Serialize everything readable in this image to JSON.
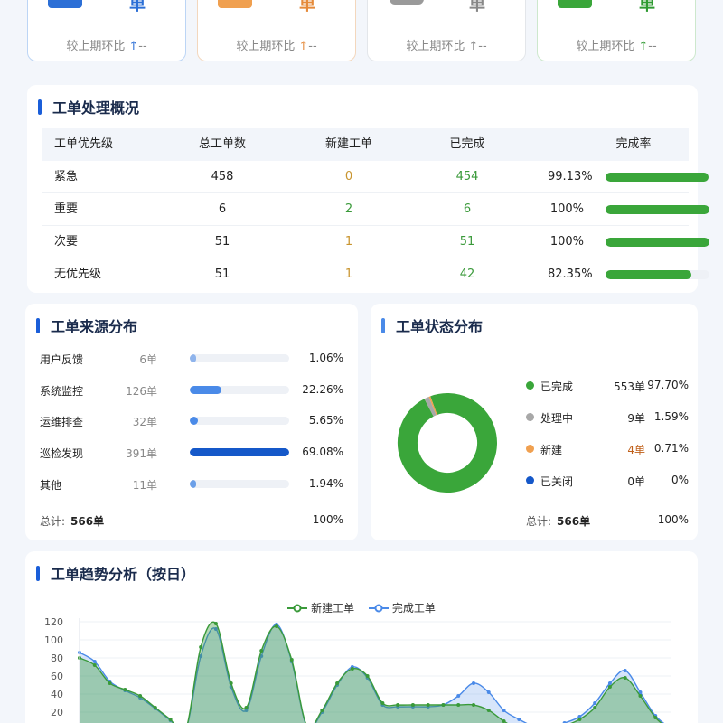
{
  "kpi_cards": [
    {
      "unit": "单",
      "compare_label": "较上期环比",
      "compare_arrow": "↑",
      "compare_value": "--",
      "color": "#2c6fd6",
      "border": "#bcd5f5",
      "arrow_color": "#2c6fd6",
      "icon_color": "#2c6fd6"
    },
    {
      "unit": "单",
      "compare_label": "较上期环比",
      "compare_arrow": "↑",
      "compare_value": "--",
      "color": "#e58a3a",
      "border": "#f3d7bd",
      "arrow_color": "#e58a3a",
      "icon_color": "#f0a050"
    },
    {
      "unit": "单",
      "compare_label": "较上期环比",
      "compare_arrow": "↑",
      "compare_value": "--",
      "color": "#888888",
      "border": "#e3e6ea",
      "arrow_color": "#888888",
      "icon_color": "#9a9a9a"
    },
    {
      "unit": "单",
      "compare_label": "较上期环比",
      "compare_arrow": "↑",
      "compare_value": "--",
      "color": "#2f9a32",
      "border": "#cde8cd",
      "arrow_color": "#2f9a32",
      "icon_color": "#3aa63a"
    }
  ],
  "overview": {
    "title": "工单处理概况",
    "headers": [
      "工单优先级",
      "总工单数",
      "新建工单",
      "已完成",
      "完成率"
    ],
    "rows": [
      {
        "priority": "紧急",
        "total": "458",
        "new": "0",
        "done": "454",
        "rate": "99.13%",
        "rate_value": 99.13
      },
      {
        "priority": "重要",
        "total": "6",
        "new": "2",
        "done": "6",
        "rate": "100%",
        "rate_value": 100
      },
      {
        "priority": "次要",
        "total": "51",
        "new": "1",
        "done": "51",
        "rate": "100%",
        "rate_value": 100
      },
      {
        "priority": "无优先级",
        "total": "51",
        "new": "1",
        "done": "42",
        "rate": "82.35%",
        "rate_value": 82.35
      }
    ]
  },
  "source": {
    "title": "工单来源分布",
    "items": [
      {
        "name": "用户反馈",
        "count": "6单",
        "pct": "1.06%",
        "value": 1.06,
        "color": "#8fb4ec"
      },
      {
        "name": "系统监控",
        "count": "126单",
        "pct": "22.26%",
        "value": 22.26,
        "color": "#4a8ae8"
      },
      {
        "name": "运维排查",
        "count": "32单",
        "pct": "5.65%",
        "value": 5.65,
        "color": "#4a8ae8"
      },
      {
        "name": "巡检发现",
        "count": "391单",
        "pct": "69.08%",
        "value": 69.08,
        "color": "#1558c9"
      },
      {
        "name": "其他",
        "count": "11单",
        "pct": "1.94%",
        "value": 1.94,
        "color": "#6b9fe8"
      }
    ],
    "total_label": "总计:",
    "total_value": "566单",
    "total_pct": "100%"
  },
  "status": {
    "title": "工单状态分布",
    "items": [
      {
        "name": "已完成",
        "count": "553单",
        "pct": "97.70%",
        "value": 97.7,
        "color": "#3aa63a",
        "count_color": "#222222"
      },
      {
        "name": "处理中",
        "count": "9单",
        "pct": "1.59%",
        "value": 1.59,
        "color": "#a8a8a8",
        "count_color": "#222222"
      },
      {
        "name": "新建",
        "count": "4单",
        "pct": "0.71%",
        "value": 0.71,
        "color": "#f0a050",
        "count_color": "#c0601a"
      },
      {
        "name": "已关闭",
        "count": "0单",
        "pct": "0%",
        "value": 0,
        "color": "#1558c9",
        "count_color": "#222222"
      }
    ],
    "total_label": "总计:",
    "total_value": "566单",
    "total_pct": "100%"
  },
  "chart_data": {
    "type": "area",
    "title": "工单趋势分析（按日）",
    "legend": [
      "新建工单",
      "完成工单"
    ],
    "legend_position": "top-center",
    "ylim": [
      0,
      120
    ],
    "yticks": [
      20,
      40,
      60,
      80,
      100,
      120
    ],
    "x": [
      0,
      1,
      2,
      3,
      4,
      5,
      6,
      7,
      8,
      9,
      10,
      11,
      12,
      13,
      14,
      15,
      16,
      17,
      18,
      19,
      20,
      21,
      22,
      23,
      24,
      25,
      26,
      27,
      28,
      29,
      30,
      31,
      32,
      33,
      34,
      35,
      36,
      37,
      38,
      39
    ],
    "series": [
      {
        "name": "新建工单",
        "color": "#3a9a3a",
        "values": [
          80,
          72,
          52,
          45,
          38,
          25,
          12,
          0,
          92,
          118,
          52,
          25,
          88,
          115,
          78,
          5,
          22,
          52,
          68,
          60,
          30,
          28,
          28,
          28,
          28,
          28,
          28,
          22,
          10,
          1,
          0,
          0,
          5,
          12,
          25,
          48,
          58,
          38,
          14,
          0
        ]
      },
      {
        "name": "完成工单",
        "color": "#4a8ae8",
        "values": [
          86,
          76,
          54,
          44,
          36,
          24,
          11,
          0,
          82,
          112,
          48,
          22,
          82,
          117,
          76,
          4,
          20,
          50,
          70,
          58,
          28,
          26,
          26,
          26,
          28,
          38,
          52,
          42,
          22,
          12,
          4,
          2,
          8,
          15,
          30,
          52,
          66,
          42,
          16,
          2
        ]
      }
    ]
  }
}
